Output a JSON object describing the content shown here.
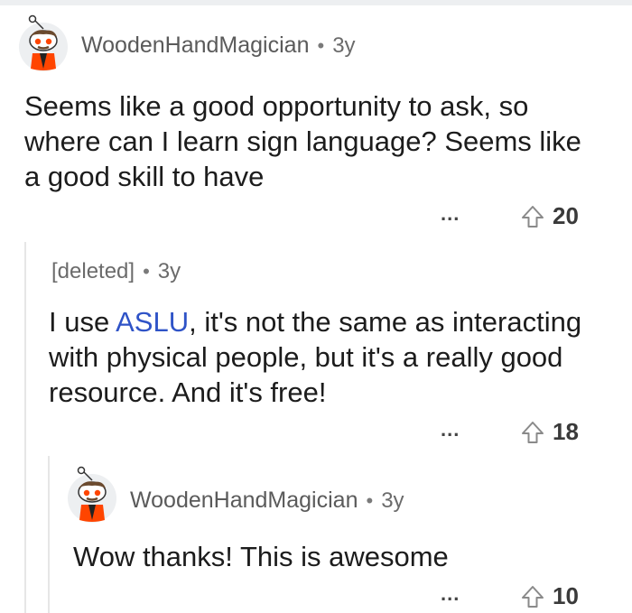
{
  "comments": [
    {
      "author": "WoodenHandMagician",
      "age": "3y",
      "body": "Seems like a good opportunity to ask, so where can I learn sign language? Seems like a good skill to have",
      "more": "...",
      "votes": "20"
    },
    {
      "author": "[deleted]",
      "age": "3y",
      "body_prefix": "I use ",
      "body_link": "ASLU",
      "body_suffix": ", it's not the same as interacting with physical people, but it's a really good resource. And it's free!",
      "more": "...",
      "votes": "18"
    },
    {
      "author": "WoodenHandMagician",
      "age": "3y",
      "body": "Wow thanks! This is awesome",
      "more": "...",
      "votes": "10"
    }
  ],
  "separator": "•",
  "icons": {
    "avatar": "snoo-avatar-icon",
    "upvote": "upvote-arrow-icon",
    "more": "more-options-icon"
  },
  "colors": {
    "link": "#2f53c7",
    "meta": "#6b6b6b",
    "thread_line": "#e6e6e6",
    "avatar_orange": "#ff4500"
  }
}
